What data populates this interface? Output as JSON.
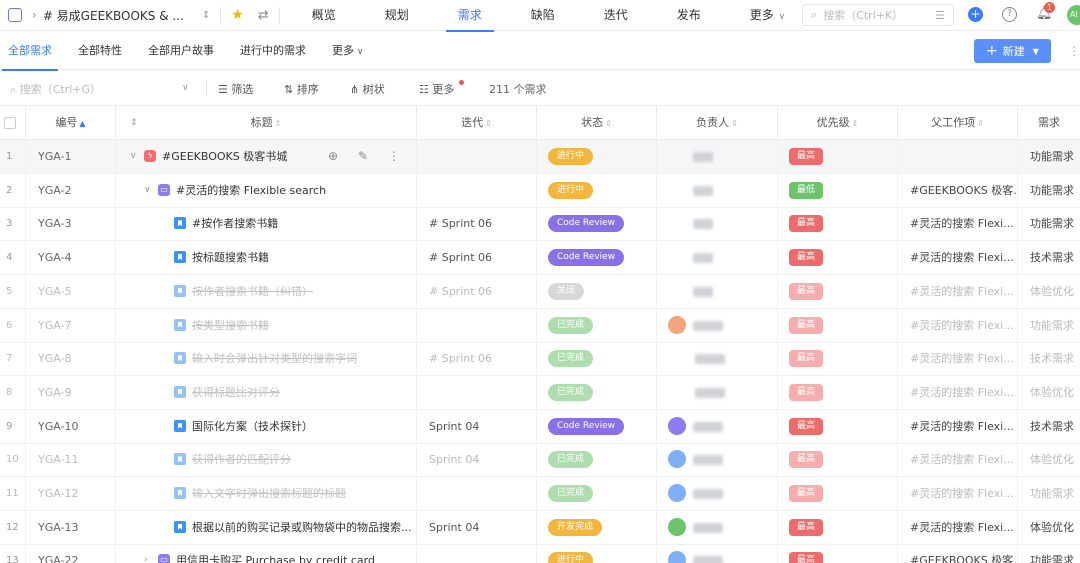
{
  "topnav": {
    "project_name": "# 易成GEEKBOOKS & ...",
    "tabs": [
      {
        "label": "概览"
      },
      {
        "label": "规划"
      },
      {
        "label": "需求"
      },
      {
        "label": "缺陷"
      },
      {
        "label": "迭代"
      },
      {
        "label": "发布"
      },
      {
        "label": "更多"
      }
    ],
    "search_placeholder": "搜索（Ctrl+K）",
    "notification_count": "1",
    "avatar_initials": "AI"
  },
  "subtabs": [
    "全部需求",
    "全部特性",
    "全部用户故事",
    "进行中的需求",
    "更多"
  ],
  "new_button": "新建",
  "toolbar": {
    "search_placeholder": "搜索（Ctrl+G）",
    "filter": "筛选",
    "sort": "排序",
    "tree": "树状",
    "more": "更多",
    "count": "211 个需求"
  },
  "columns": {
    "id": "编号",
    "title": "标题",
    "iteration": "迭代",
    "status": "状态",
    "owner": "负责人",
    "priority": "优先级",
    "parent": "父工作项",
    "type": "需求"
  },
  "status_colors": {
    "进行中": "#f2b63f",
    "Code Review": "#8a70e8",
    "关闭": "#b7b7b7",
    "已完成": "#6cc46b",
    "开发完成": "#f2b63f"
  },
  "priority_colors": {
    "最高": "#ee6b6b",
    "最低": "#6cc46b"
  },
  "rows": [
    {
      "no": "1",
      "id": "YGA-1",
      "title": "#GEEKBOOKS 极客书城",
      "level": 0,
      "kind": "epic",
      "iteration": "",
      "status": "进行中",
      "owner": "blur",
      "priority": "最高",
      "parent": "",
      "type": "功能需求",
      "dim": false
    },
    {
      "no": "2",
      "id": "YGA-2",
      "title": "#灵活的搜索 Flexible search",
      "level": 1,
      "kind": "feature",
      "iteration": "",
      "status": "进行中",
      "owner": "blur",
      "priority": "最低",
      "parent": "#GEEKBOOKS 极客...",
      "type": "功能需求",
      "dim": false
    },
    {
      "no": "3",
      "id": "YGA-3",
      "title": "#按作者搜索书籍",
      "level": 2,
      "kind": "story",
      "iteration": "# Sprint 06",
      "status": "Code Review",
      "owner": "blur",
      "priority": "最高",
      "parent": "#灵活的搜索 Flexi...",
      "type": "功能需求",
      "dim": false
    },
    {
      "no": "4",
      "id": "YGA-4",
      "title": "按标题搜索书籍",
      "level": 2,
      "kind": "story",
      "iteration": "# Sprint 06",
      "status": "Code Review",
      "owner": "blur",
      "priority": "最高",
      "parent": "#灵活的搜索 Flexi...",
      "type": "技术需求",
      "dim": false
    },
    {
      "no": "5",
      "id": "YGA-5",
      "title": "按作者搜索书籍（纠错）",
      "level": 2,
      "kind": "story",
      "iteration": "# Sprint 06",
      "status": "关闭",
      "owner": "blur",
      "priority": "最高",
      "parent": "#灵活的搜索 Flexi...",
      "type": "体验优化",
      "dim": true
    },
    {
      "no": "6",
      "id": "YGA-7",
      "title": "按类型搜索书籍",
      "level": 2,
      "kind": "story",
      "iteration": "",
      "status": "已完成",
      "owner": "avatar-orange",
      "priority": "最高",
      "parent": "#灵活的搜索 Flexi...",
      "type": "功能需求",
      "dim": true
    },
    {
      "no": "7",
      "id": "YGA-8",
      "title": "输入时会弹出针对类型的搜索字词",
      "level": 2,
      "kind": "story",
      "iteration": "# Sprint 06",
      "status": "已完成",
      "owner": "blur-long",
      "priority": "最高",
      "parent": "#灵活的搜索 Flexi...",
      "type": "技术需求",
      "dim": true
    },
    {
      "no": "8",
      "id": "YGA-9",
      "title": "获得标题比对评分",
      "level": 2,
      "kind": "story",
      "iteration": "",
      "status": "已完成",
      "owner": "blur-long",
      "priority": "最高",
      "parent": "#灵活的搜索 Flexi...",
      "type": "体验优化",
      "dim": true
    },
    {
      "no": "9",
      "id": "YGA-10",
      "title": "国际化方案（技术探针）",
      "level": 2,
      "kind": "story",
      "iteration": "Sprint 04",
      "status": "Code Review",
      "owner": "avatar-purple",
      "priority": "最高",
      "parent": "#灵活的搜索 Flexi...",
      "type": "技术需求",
      "dim": false
    },
    {
      "no": "10",
      "id": "YGA-11",
      "title": "获得作者的匹配评分",
      "level": 2,
      "kind": "story",
      "iteration": "Sprint 04",
      "status": "已完成",
      "owner": "avatar-blue",
      "priority": "最高",
      "parent": "#灵活的搜索 Flexi...",
      "type": "体验优化",
      "dim": true
    },
    {
      "no": "11",
      "id": "YGA-12",
      "title": "输入文字时弹出搜索标题的标题",
      "level": 2,
      "kind": "story",
      "iteration": "",
      "status": "已完成",
      "owner": "avatar-blue",
      "priority": "最高",
      "parent": "#灵活的搜索 Flexi...",
      "type": "功能需求",
      "dim": true
    },
    {
      "no": "12",
      "id": "YGA-13",
      "title": "根据以前的购买记录或购物袋中的物品搜索...",
      "level": 2,
      "kind": "story",
      "iteration": "Sprint 04",
      "status": "开发完成",
      "owner": "avatar-green",
      "priority": "最高",
      "parent": "#灵活的搜索 Flexi...",
      "type": "体验优化",
      "dim": false
    },
    {
      "no": "13",
      "id": "YGA-22",
      "title": "用信用卡购买 Purchase by credit card",
      "level": 1,
      "kind": "feature",
      "iteration": "",
      "status": "进行中",
      "owner": "avatar-blue",
      "priority": "最高",
      "parent": "#GEEKBOOKS 极客...",
      "type": "功能需求",
      "dim": false
    }
  ]
}
